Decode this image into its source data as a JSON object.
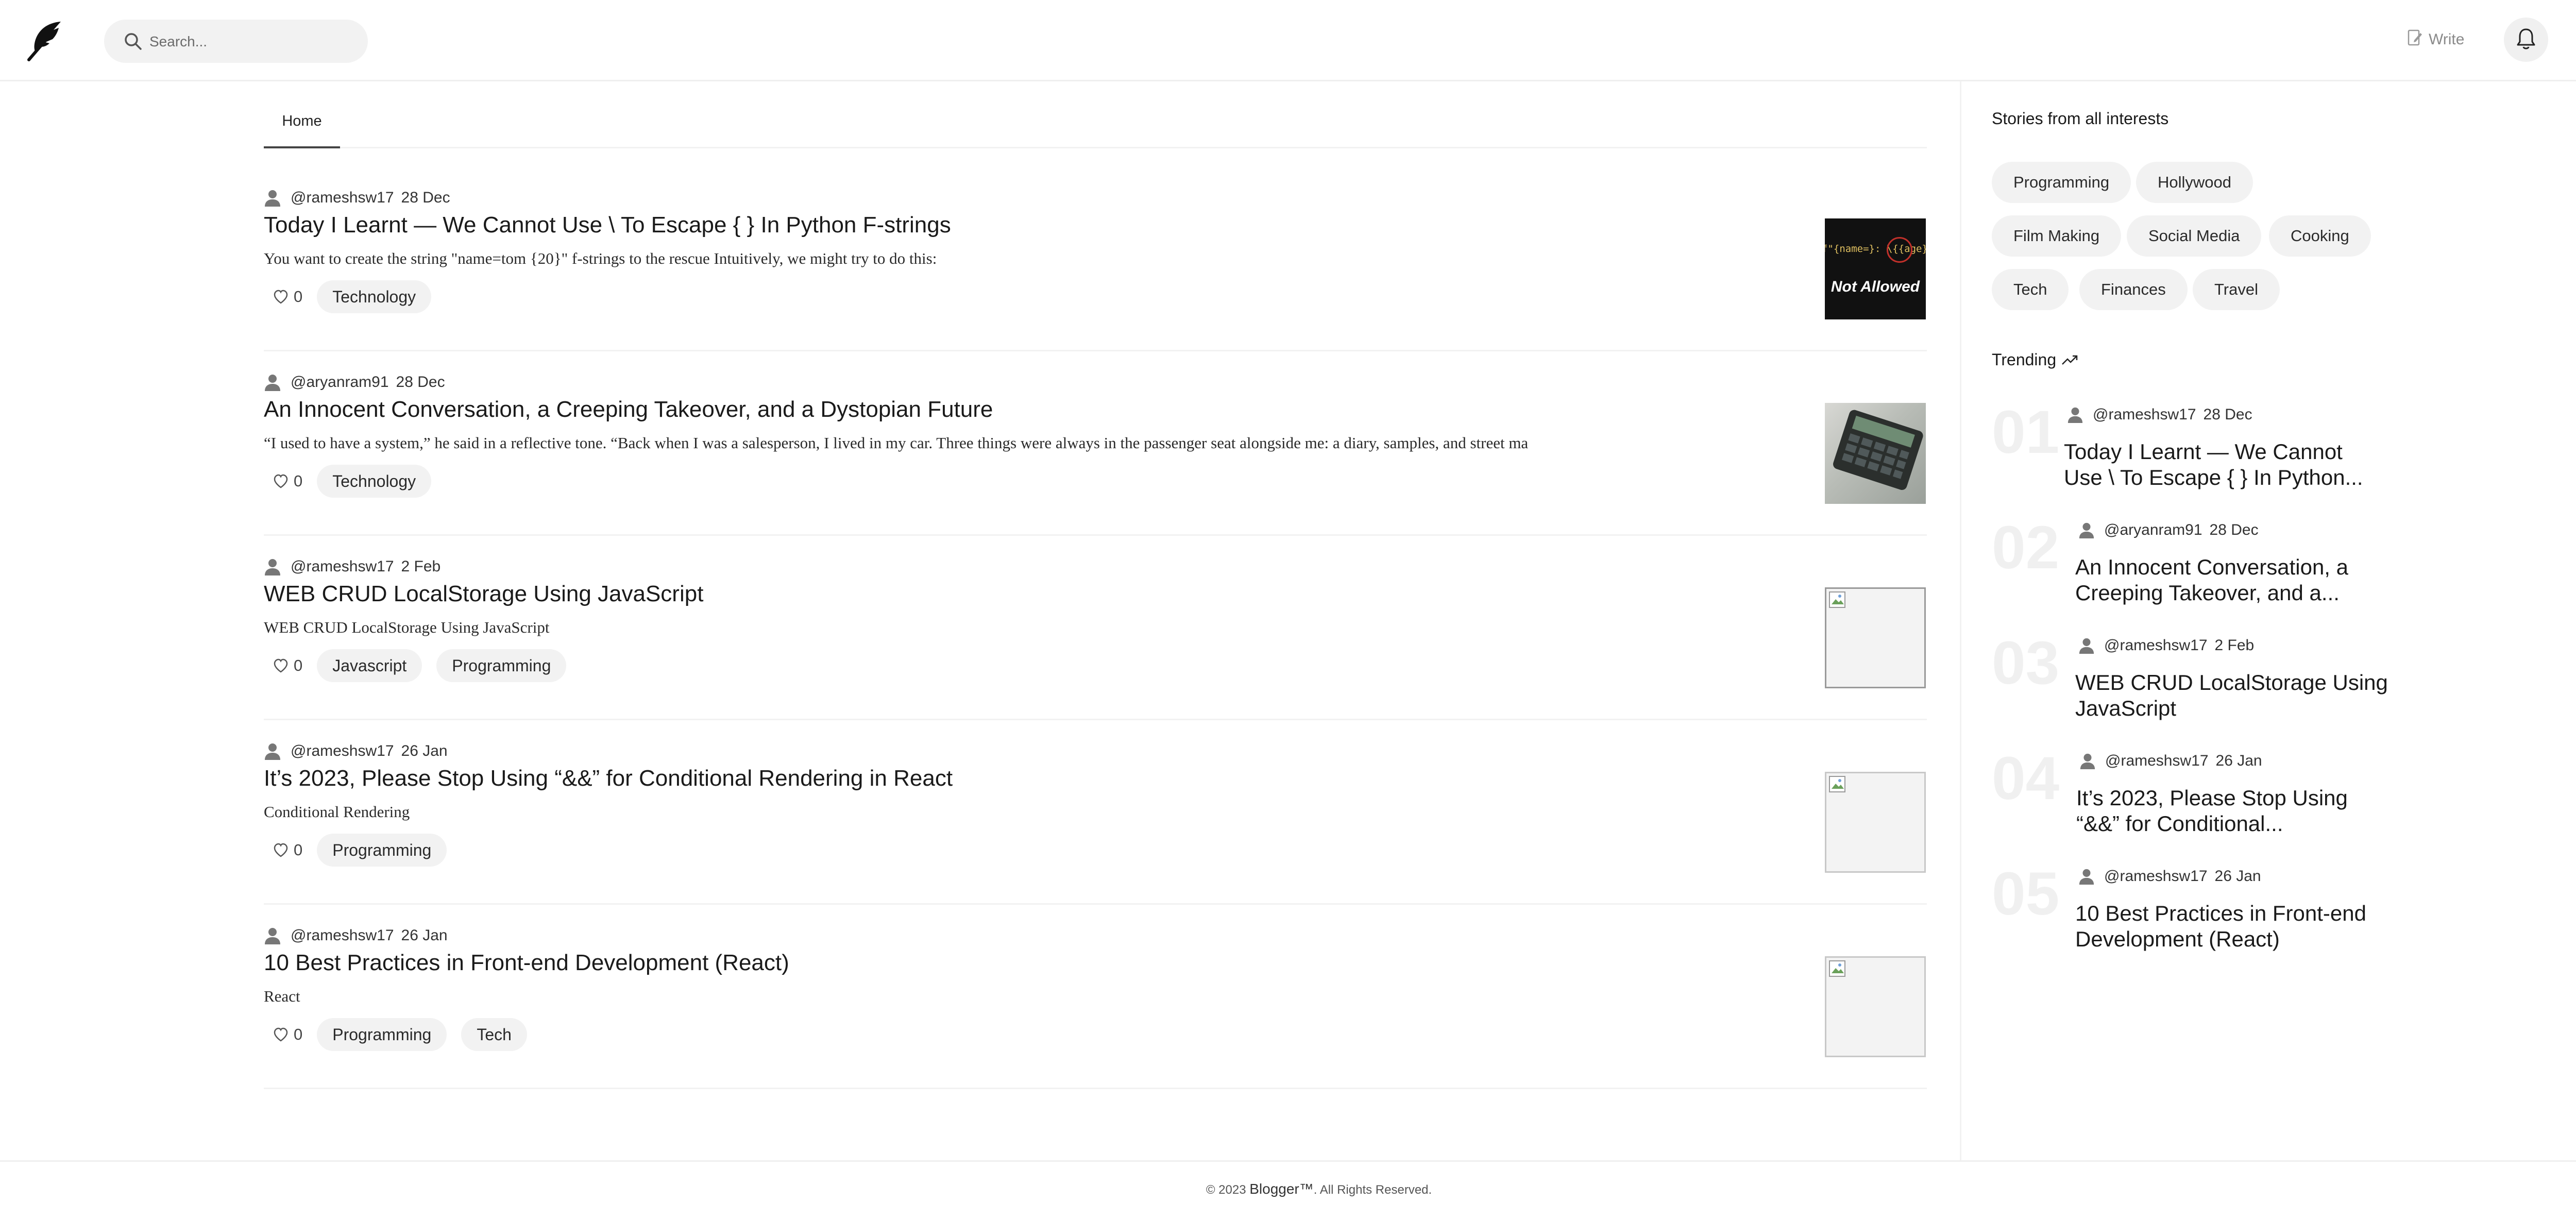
{
  "header": {
    "search_placeholder": "Search...",
    "write_label": "Write"
  },
  "tabs": [
    {
      "label": "Home"
    }
  ],
  "posts": [
    {
      "author": "@rameshsw17",
      "date": "28 Dec",
      "title": "Today I Learnt — We Cannot Use \\ To Escape { } In Python F-strings",
      "snippet": "You want to create the string \"name=tom {20}\" f-strings to the rescue Intuitively, we might try to do this:",
      "likes": "0",
      "tags": [
        "Technology"
      ],
      "thumb_caption": "Not Allowed",
      "thumb_code": "f\"{name=}: \\{{age}}\""
    },
    {
      "author": "@aryanram91",
      "date": "28 Dec",
      "title": "An Innocent Conversation, a Creeping Takeover, and a Dystopian Future",
      "snippet": "“I used to have a system,” he said in a reflective tone. “Back when I was a salesperson, I lived in my car. Three things were always in the passenger seat alongside me: a diary, samples, and street ma",
      "likes": "0",
      "tags": [
        "Technology"
      ]
    },
    {
      "author": "@rameshsw17",
      "date": "2 Feb",
      "title": "WEB CRUD LocalStorage Using JavaScript",
      "snippet": "WEB CRUD LocalStorage Using JavaScript",
      "likes": "0",
      "tags": [
        "Javascript",
        "Programming"
      ]
    },
    {
      "author": "@rameshsw17",
      "date": "26 Jan",
      "title": "It’s 2023, Please Stop Using “&&” for Conditional Rendering in React",
      "snippet": "Conditional Rendering",
      "likes": "0",
      "tags": [
        "Programming"
      ]
    },
    {
      "author": "@rameshsw17",
      "date": "26 Jan",
      "title": "10 Best Practices in Front-end Development (React)",
      "snippet": "React",
      "likes": "0",
      "tags": [
        "Programming",
        "Tech"
      ]
    }
  ],
  "sidebar": {
    "interests_heading": "Stories from all interests",
    "interests": [
      "Programming",
      "Hollywood",
      "Film Making",
      "Social Media",
      "Cooking",
      "Tech",
      "Finances",
      "Travel"
    ],
    "trending_heading": "Trending",
    "trending": [
      {
        "num": "01",
        "author": "@rameshsw17",
        "date": "28 Dec",
        "title": "Today I Learnt — We Cannot Use \\ To Escape { } In Python..."
      },
      {
        "num": "02",
        "author": "@aryanram91",
        "date": "28 Dec",
        "title": "An Innocent Conversation, a Creeping Takeover, and a..."
      },
      {
        "num": "03",
        "author": "@rameshsw17",
        "date": "2 Feb",
        "title": "WEB CRUD LocalStorage Using JavaScript"
      },
      {
        "num": "04",
        "author": "@rameshsw17",
        "date": "26 Jan",
        "title": "It’s 2023, Please Stop Using “&&” for Conditional..."
      },
      {
        "num": "05",
        "author": "@rameshsw17",
        "date": "26 Jan",
        "title": "10 Best Practices in Front-end Development (React)"
      }
    ]
  },
  "footer": {
    "prefix": "© 2023 ",
    "brand": "Blogger™",
    "suffix": ". All Rights Reserved."
  }
}
